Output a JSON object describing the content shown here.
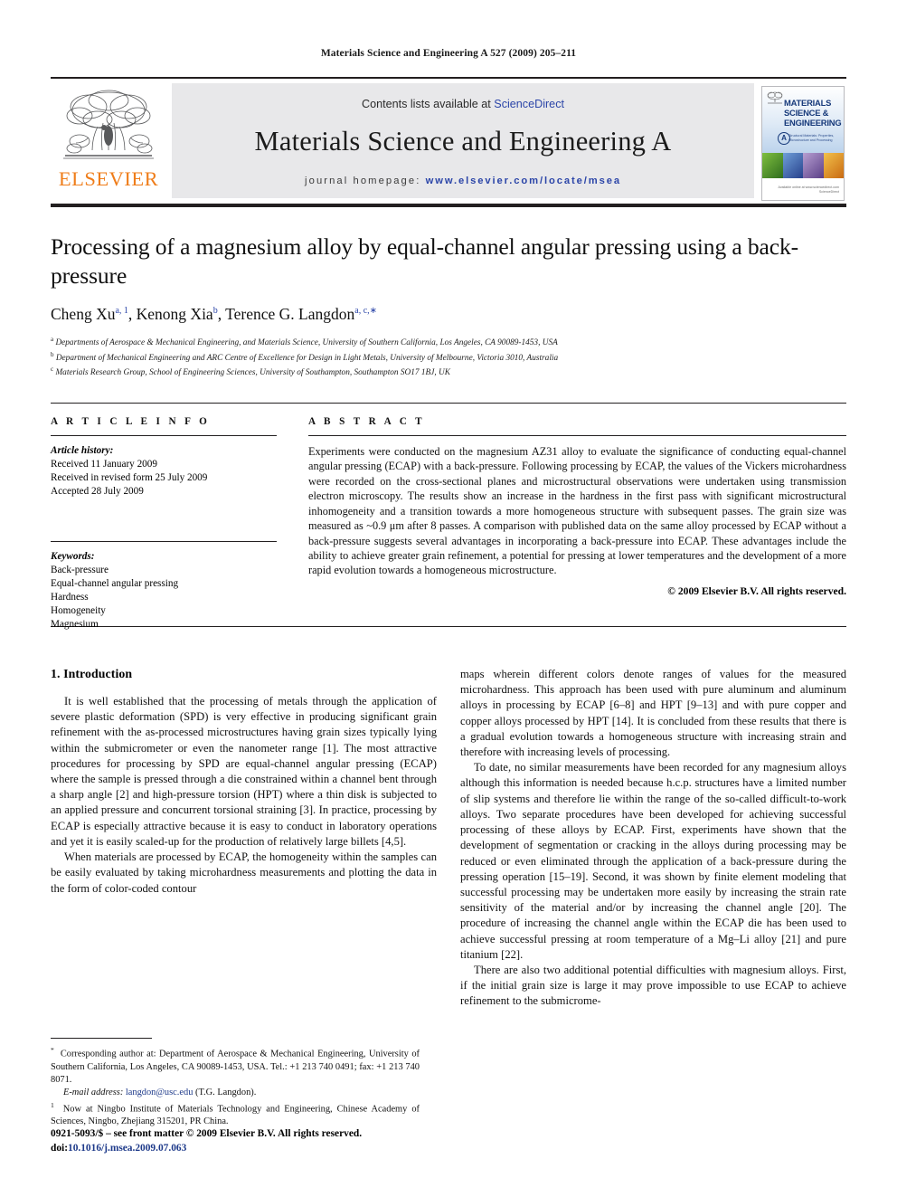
{
  "running_head": "Materials Science and Engineering A 527 (2009) 205–211",
  "masthead": {
    "publisher_wordmark": "ELSEVIER",
    "contents_prefix": "Contents lists available at ",
    "contents_link": "ScienceDirect",
    "journal_title": "Materials Science and Engineering A",
    "homepage_prefix": "journal homepage: ",
    "homepage_url": "www.elsevier.com/locate/msea",
    "cover": {
      "title_line1": "MATERIALS",
      "title_line2": "SCIENCE &",
      "title_line3": "ENGINEERING",
      "series_letter": "A",
      "subtitle": "Structural Materials: Properties, Microstructure and Processing",
      "footer": "Available online at www.sciencedirect.com ScienceDirect"
    }
  },
  "article": {
    "title": "Processing of a magnesium alloy by equal-channel angular pressing using a back-pressure",
    "authors": [
      {
        "name": "Cheng Xu",
        "sup": "a, 1",
        "sep": ", "
      },
      {
        "name": "Kenong Xia",
        "sup": "b",
        "sep": ", "
      },
      {
        "name": "Terence G. Langdon",
        "sup": "a, c,∗",
        "sep": ""
      }
    ],
    "affiliations": [
      {
        "mark": "a",
        "text": "Departments of Aerospace & Mechanical Engineering, and Materials Science, University of Southern California, Los Angeles, CA 90089-1453, USA"
      },
      {
        "mark": "b",
        "text": "Department of Mechanical Engineering and ARC Centre of Excellence for Design in Light Metals, University of Melbourne, Victoria 3010, Australia"
      },
      {
        "mark": "c",
        "text": "Materials Research Group, School of Engineering Sciences, University of Southampton, Southampton SO17 1BJ, UK"
      }
    ]
  },
  "article_info": {
    "heading": "A R T I C L E  I N F O",
    "history_label": "Article history:",
    "history": [
      "Received 11 January 2009",
      "Received in revised form 25 July 2009",
      "Accepted 28 July 2009"
    ],
    "keywords_label": "Keywords:",
    "keywords": [
      "Back-pressure",
      "Equal-channel angular pressing",
      "Hardness",
      "Homogeneity",
      "Magnesium"
    ]
  },
  "abstract": {
    "heading": "A B S T R A C T",
    "text": "Experiments were conducted on the magnesium AZ31 alloy to evaluate the significance of conducting equal-channel angular pressing (ECAP) with a back-pressure. Following processing by ECAP, the values of the Vickers microhardness were recorded on the cross-sectional planes and microstructural observations were undertaken using transmission electron microscopy. The results show an increase in the hardness in the first pass with significant microstructural inhomogeneity and a transition towards a more homogeneous structure with subsequent passes. The grain size was measured as ~0.9 μm after 8 passes. A comparison with published data on the same alloy processed by ECAP without a back-pressure suggests several advantages in incorporating a back-pressure into ECAP. These advantages include the ability to achieve greater grain refinement, a potential for pressing at lower temperatures and the development of a more rapid evolution towards a homogeneous microstructure.",
    "copyright": "© 2009 Elsevier B.V. All rights reserved."
  },
  "body": {
    "section_number_title": "1.  Introduction",
    "left_paragraphs": [
      "It is well established that the processing of metals through the application of severe plastic deformation (SPD) is very effective in producing significant grain refinement with the as-processed microstructures having grain sizes typically lying within the submicrometer or even the nanometer range [1]. The most attractive procedures for processing by SPD are equal-channel angular pressing (ECAP) where the sample is pressed through a die constrained within a channel bent through a sharp angle [2] and high-pressure torsion (HPT) where a thin disk is subjected to an applied pressure and concurrent torsional straining [3]. In practice, processing by ECAP is especially attractive because it is easy to conduct in laboratory operations and yet it is easily scaled-up for the production of relatively large billets [4,5].",
      "When materials are processed by ECAP, the homogeneity within the samples can be easily evaluated by taking microhardness measurements and plotting the data in the form of color-coded contour"
    ],
    "right_paragraphs": [
      "maps wherein different colors denote ranges of values for the measured microhardness. This approach has been used with pure aluminum and aluminum alloys in processing by ECAP [6–8] and HPT [9–13] and with pure copper and copper alloys processed by HPT [14]. It is concluded from these results that there is a gradual evolution towards a homogeneous structure with increasing strain and therefore with increasing levels of processing.",
      "To date, no similar measurements have been recorded for any magnesium alloys although this information is needed because h.c.p. structures have a limited number of slip systems and therefore lie within the range of the so-called difficult-to-work alloys. Two separate procedures have been developed for achieving successful processing of these alloys by ECAP. First, experiments have shown that the development of segmentation or cracking in the alloys during processing may be reduced or even eliminated through the application of a back-pressure during the pressing operation [15–19]. Second, it was shown by finite element modeling that successful processing may be undertaken more easily by increasing the strain rate sensitivity of the material and/or by increasing the channel angle [20]. The procedure of increasing the channel angle within the ECAP die has been used to achieve successful pressing at room temperature of a Mg–Li alloy [21] and pure titanium [22].",
      "There are also two additional potential difficulties with magnesium alloys. First, if the initial grain size is large it may prove impossible to use ECAP to achieve refinement to the submicrome-"
    ]
  },
  "footnotes": {
    "corresponding": "Corresponding author at: Department of Aerospace & Mechanical Engineering, University of Southern California, Los Angeles, CA 90089-1453, USA. Tel.: +1 213 740 0491; fax: +1 213 740 8071.",
    "email_label": "E-mail address:",
    "email": "langdon@usc.edu",
    "email_suffix": "(T.G. Langdon).",
    "note1": "Now at Ningbo Institute of Materials Technology and Engineering, Chinese Academy of Sciences, Ningbo, Zhejiang 315201, PR China."
  },
  "imprint": {
    "line1": "0921-5093/$ – see front matter © 2009 Elsevier B.V. All rights reserved.",
    "doi_label": "doi:",
    "doi": "10.1016/j.msea.2009.07.063"
  },
  "colors": {
    "elsevier_orange": "#ef7d1a",
    "link_blue": "#2b45a8",
    "reference_blue": "#1e3a8a",
    "band_gray": "#e8e8ea",
    "rule_black": "#231f20"
  }
}
